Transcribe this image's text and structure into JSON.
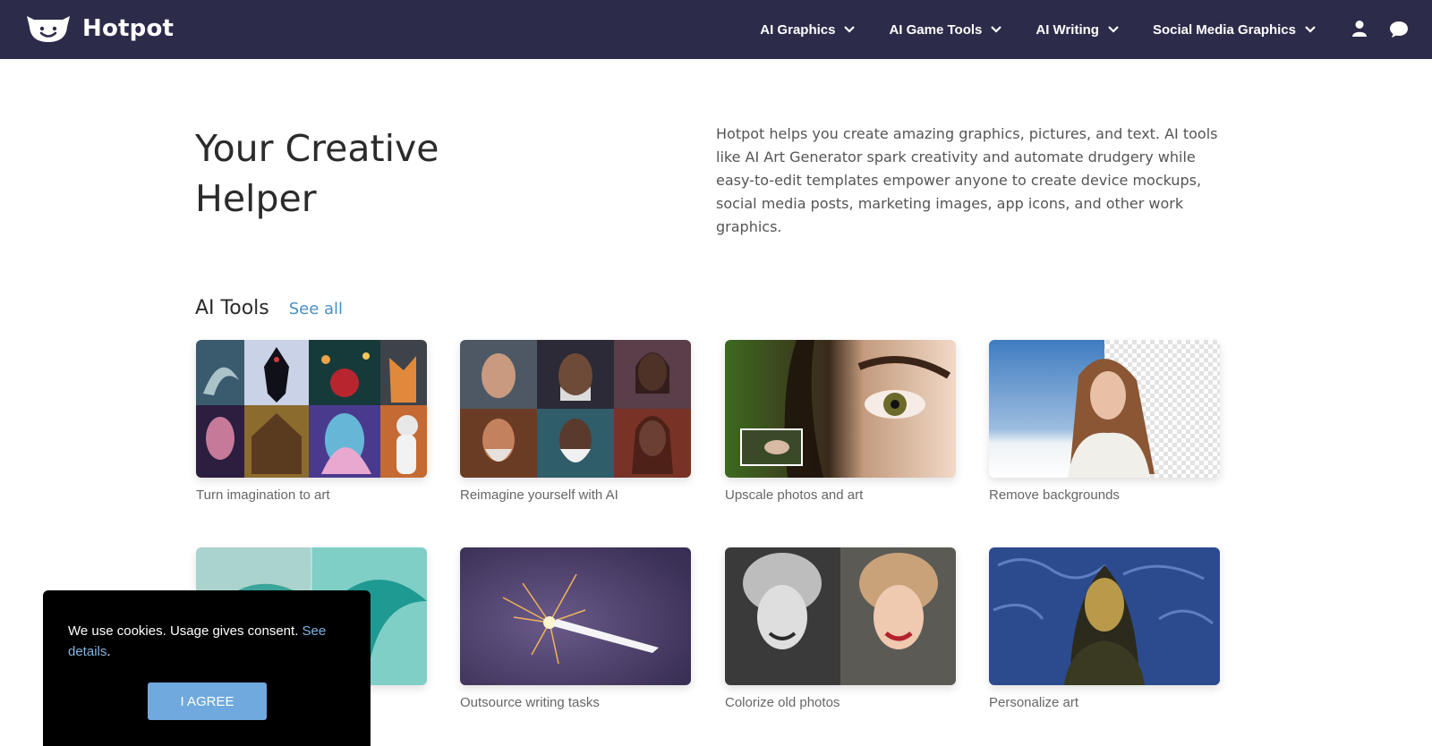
{
  "brand": {
    "name": "Hotpot"
  },
  "nav": {
    "items": [
      {
        "label": "AI Graphics"
      },
      {
        "label": "AI Game Tools"
      },
      {
        "label": "AI Writing"
      },
      {
        "label": "Social Media Graphics"
      }
    ],
    "icons": [
      "user-icon",
      "chat-icon"
    ]
  },
  "hero": {
    "title": "Your Creative Helper",
    "description": "Hotpot helps you create amazing graphics, pictures, and text. AI tools like AI Art Generator spark creativity and automate drudgery while easy-to-edit templates empower anyone to create device mockups, social media posts, marketing images, app icons, and other work graphics."
  },
  "ai_tools": {
    "title": "AI Tools",
    "see_all": "See all",
    "cards": [
      {
        "label": "Turn imagination to art"
      },
      {
        "label": "Reimagine yourself with AI"
      },
      {
        "label": "Upscale photos and art"
      },
      {
        "label": "Remove backgrounds"
      },
      {
        "label": ""
      },
      {
        "label": "Outsource writing tasks"
      },
      {
        "label": "Colorize old photos"
      },
      {
        "label": "Personalize art"
      }
    ]
  },
  "cookie": {
    "text": "We use cookies. Usage gives consent.",
    "link": "See details",
    "period": ".",
    "button": "I AGREE"
  },
  "colors": {
    "topbar": "#2d2b4a",
    "accent_link": "#4a90c8",
    "agree_button": "#6fa9dd"
  }
}
